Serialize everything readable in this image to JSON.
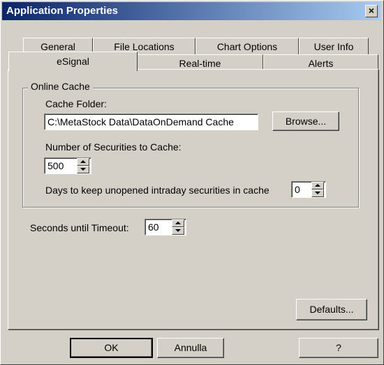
{
  "window": {
    "title": "Application Properties",
    "close_symbol": "×"
  },
  "tabs": {
    "back_row": [
      {
        "label": "General"
      },
      {
        "label": "File Locations"
      },
      {
        "label": "Chart Options"
      },
      {
        "label": "User Info"
      }
    ],
    "front_row": [
      {
        "label": "eSignal",
        "active": true
      },
      {
        "label": "Real-time"
      },
      {
        "label": "Alerts"
      }
    ]
  },
  "online_cache": {
    "group_title": "Online Cache",
    "cache_folder_label": "Cache Folder:",
    "cache_folder_value": "C:\\MetaStock Data\\DataOnDemand Cache",
    "browse_label": "Browse...",
    "num_securities_label": "Number of Securities to Cache:",
    "num_securities_value": "500",
    "days_keep_label": "Days to keep unopened intraday securities in cache",
    "days_keep_value": "0"
  },
  "timeout": {
    "label": "Seconds until Timeout:",
    "value": "60"
  },
  "buttons": {
    "defaults": "Defaults...",
    "ok": "OK",
    "cancel": "Annulla",
    "help": "?"
  }
}
